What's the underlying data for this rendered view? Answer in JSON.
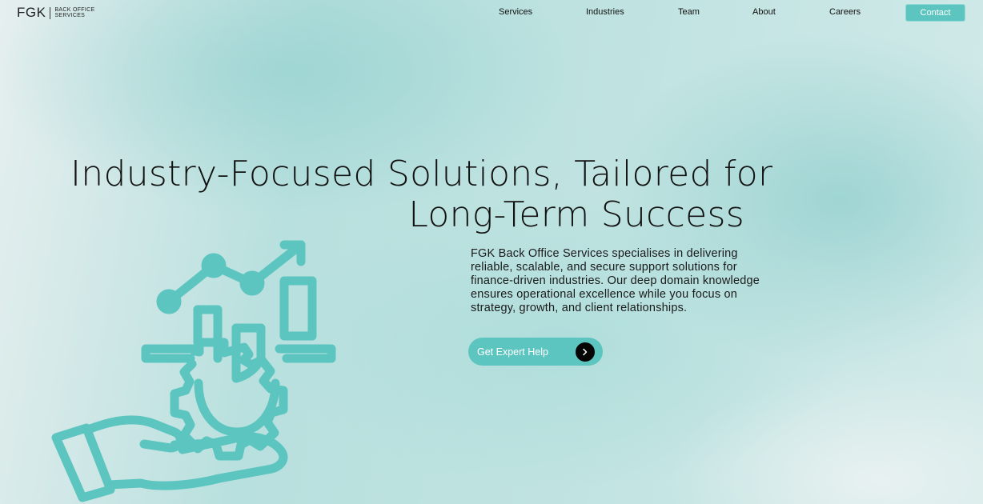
{
  "brand": {
    "mark": "FGK",
    "subtitle_line1": "BACK OFFICE",
    "subtitle_line2": "SERVICES"
  },
  "nav": {
    "services": "Services",
    "industries": "Industries",
    "team": "Team",
    "about": "About",
    "careers": "Careers",
    "contact": "Contact"
  },
  "hero": {
    "headline_line1": "Industry-Focused Solutions, Tailored for",
    "headline_line2": "Long-Term Success",
    "description": "FGK Back Office Services specialises in delivering reliable, scalable, and secure support solutions for finance-driven industries. Our deep domain knowledge ensures operational excellence while you focus on strategy, growth, and client relationships.",
    "cta_label": "Get Expert Help",
    "cta_icon": "chevron-right-icon",
    "illustration_icon": "hand-gear-growth-chart-icon"
  },
  "colors": {
    "accent": "#5cc5c0",
    "text": "#111111",
    "cta_arrow_bg": "#050505"
  }
}
